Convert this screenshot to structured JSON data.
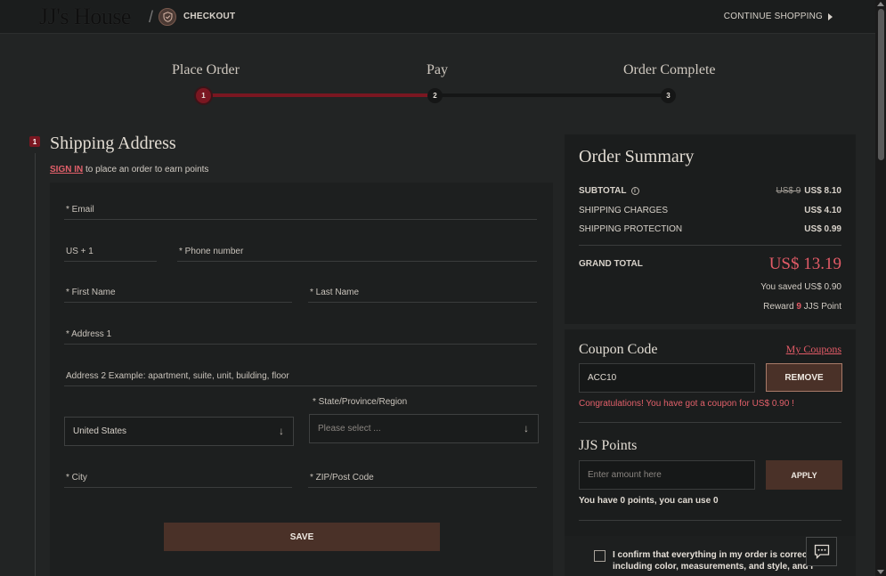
{
  "header": {
    "logo": "JJ's House",
    "checkout_label": "CHECKOUT",
    "continue_label": "CONTINUE SHOPPING"
  },
  "steps": [
    {
      "label": "Place Order",
      "num": "1"
    },
    {
      "label": "Pay",
      "num": "2"
    },
    {
      "label": "Order Complete",
      "num": "3"
    }
  ],
  "shipping": {
    "section_num": "1",
    "title": "Shipping Address",
    "sign_in": "SIGN IN",
    "sign_in_rest": " to place an order to earn points",
    "fields": {
      "email": "* Email",
      "phone_code": "US + 1",
      "phone": "* Phone number",
      "first_name": "* First Name",
      "last_name": "* Last Name",
      "address1": "* Address 1",
      "address2": "Address 2 Example: apartment, suite, unit, building, floor",
      "country": "United States",
      "state_label": "* State/Province/Region",
      "state_placeholder": "Please select ...",
      "city": "* City",
      "zip": "* ZIP/Post Code"
    },
    "save_label": "SAVE"
  },
  "summary": {
    "title": "Order Summary",
    "subtotal_label": "SUBTOTAL",
    "subtotal_old": "US$ 9",
    "subtotal": "US$ 8.10",
    "shipping_label": "SHIPPING CHARGES",
    "shipping": "US$ 4.10",
    "protection_label": "SHIPPING PROTECTION",
    "protection": "US$ 0.99",
    "grand_label": "GRAND TOTAL",
    "grand": "US$ 13.19",
    "saved": "You saved US$ 0.90",
    "reward_prefix": "Reward ",
    "reward_points": "9",
    "reward_suffix": " JJS Point"
  },
  "coupon": {
    "title": "Coupon Code",
    "my_coupons": "My Coupons",
    "code": "ACC10",
    "remove_label": "REMOVE",
    "message": "Congratulations! You have got a coupon for US$ 0.90 !"
  },
  "points": {
    "title": "JJS Points",
    "placeholder": "Enter amount here",
    "apply_label": "APPLY",
    "info": "You have 0 points, you can use 0"
  },
  "confirm": {
    "text": "I confirm that everything in my order is correct, including color, measurements, and style, and I"
  },
  "colors": {
    "accent": "#e35b67",
    "progress": "#7a1721",
    "button": "#4a3128"
  }
}
